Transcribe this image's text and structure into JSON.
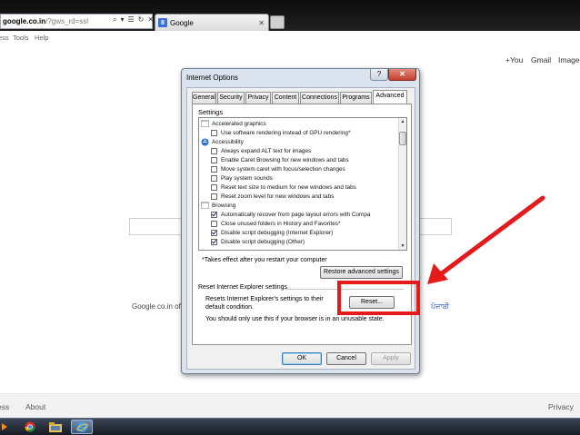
{
  "browser": {
    "address_domain": "google.co.in",
    "address_path": "/?gws_rd=ssl",
    "address_icons": [
      "⌕",
      "▾",
      "☰",
      "↻",
      "✕"
    ],
    "tab_icon": "8",
    "tab_title": "Google",
    "tab_close": "✕",
    "menu": [
      "ess",
      "Tools",
      "Help"
    ]
  },
  "google": {
    "you": "+You",
    "gmail": "Gmail",
    "images": "Images",
    "offered_in": "Google.co.in offe",
    "punjabi": "ਪੰਜਾਬੀ",
    "footer_left_1": "ess",
    "footer_left_2": "About",
    "footer_right": "Privacy"
  },
  "dialog": {
    "title": "Internet Options",
    "help_glyph": "?",
    "close_glyph": "✕",
    "tabs": [
      "General",
      "Security",
      "Privacy",
      "Content",
      "Connections",
      "Programs",
      "Advanced"
    ],
    "active_tab": "Advanced",
    "settings_label": "Settings",
    "tree": [
      {
        "kind": "category",
        "label": "Accelerated graphics"
      },
      {
        "kind": "check",
        "checked": false,
        "label": "Use software rendering instead of GPU rendering*"
      },
      {
        "kind": "category",
        "label": "Accessibility"
      },
      {
        "kind": "check",
        "checked": false,
        "label": "Always expand ALT text for images"
      },
      {
        "kind": "check",
        "checked": false,
        "label": "Enable Caret Browsing for new windows and tabs"
      },
      {
        "kind": "check",
        "checked": false,
        "label": "Move system caret with focus/selection changes"
      },
      {
        "kind": "check",
        "checked": false,
        "label": "Play system sounds"
      },
      {
        "kind": "check",
        "checked": false,
        "label": "Reset text size to medium for new windows and tabs"
      },
      {
        "kind": "check",
        "checked": false,
        "label": "Reset zoom level for new windows and tabs"
      },
      {
        "kind": "category",
        "label": "Browsing"
      },
      {
        "kind": "check",
        "checked": true,
        "label": "Automatically recover from page layout errors with Compa"
      },
      {
        "kind": "check",
        "checked": false,
        "label": "Close unused folders in History and Favorites*"
      },
      {
        "kind": "check",
        "checked": true,
        "label": "Disable script debugging (Internet Explorer)"
      },
      {
        "kind": "check",
        "checked": true,
        "label": "Disable script debugging (Other)"
      }
    ],
    "restart_note": "*Takes effect after you restart your computer",
    "restore_button": "Restore advanced settings",
    "reset_section_label": "Reset Internet Explorer settings",
    "reset_desc": "Resets Internet Explorer's settings to their default condition.",
    "reset_button": "Reset...",
    "warning": "You should only use this if your browser is in an unusable state.",
    "ok": "OK",
    "cancel": "Cancel",
    "apply": "Apply"
  },
  "colors": {
    "annotation": "#e51b1b",
    "link": "#1a4ab5"
  }
}
